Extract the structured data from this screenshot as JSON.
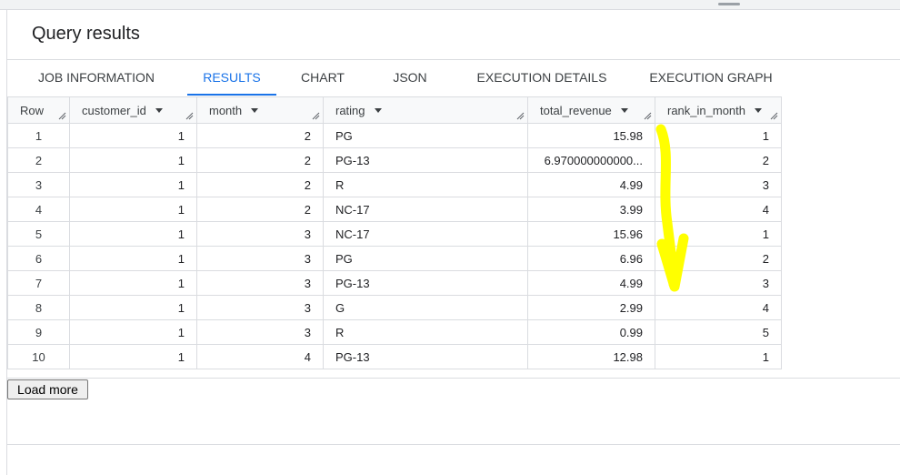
{
  "panel": {
    "title": "Query results"
  },
  "tabs": [
    {
      "label": "JOB INFORMATION",
      "active": false
    },
    {
      "label": "RESULTS",
      "active": true
    },
    {
      "label": "CHART",
      "active": false
    },
    {
      "label": "JSON",
      "active": false
    },
    {
      "label": "EXECUTION DETAILS",
      "active": false
    },
    {
      "label": "EXECUTION GRAPH",
      "active": false
    }
  ],
  "table": {
    "columns": [
      "Row",
      "customer_id",
      "month",
      "rating",
      "total_revenue",
      "rank_in_month"
    ],
    "rows": [
      [
        "1",
        "1",
        "2",
        "PG",
        "15.98",
        "1"
      ],
      [
        "2",
        "1",
        "2",
        "PG-13",
        "6.970000000000...",
        "2"
      ],
      [
        "3",
        "1",
        "2",
        "R",
        "4.99",
        "3"
      ],
      [
        "4",
        "1",
        "2",
        "NC-17",
        "3.99",
        "4"
      ],
      [
        "5",
        "1",
        "3",
        "NC-17",
        "15.96",
        "1"
      ],
      [
        "6",
        "1",
        "3",
        "PG",
        "6.96",
        "2"
      ],
      [
        "7",
        "1",
        "3",
        "PG-13",
        "4.99",
        "3"
      ],
      [
        "8",
        "1",
        "3",
        "G",
        "2.99",
        "4"
      ],
      [
        "9",
        "1",
        "3",
        "R",
        "0.99",
        "5"
      ],
      [
        "10",
        "1",
        "4",
        "PG-13",
        "12.98",
        "1"
      ]
    ]
  },
  "load_more_label": "Load more",
  "colors": {
    "accent": "#1a73e8",
    "annotation_highlight": "#ffff00"
  },
  "icons": {
    "sort": "caret-down-icon",
    "resize": "column-resize-icon"
  }
}
